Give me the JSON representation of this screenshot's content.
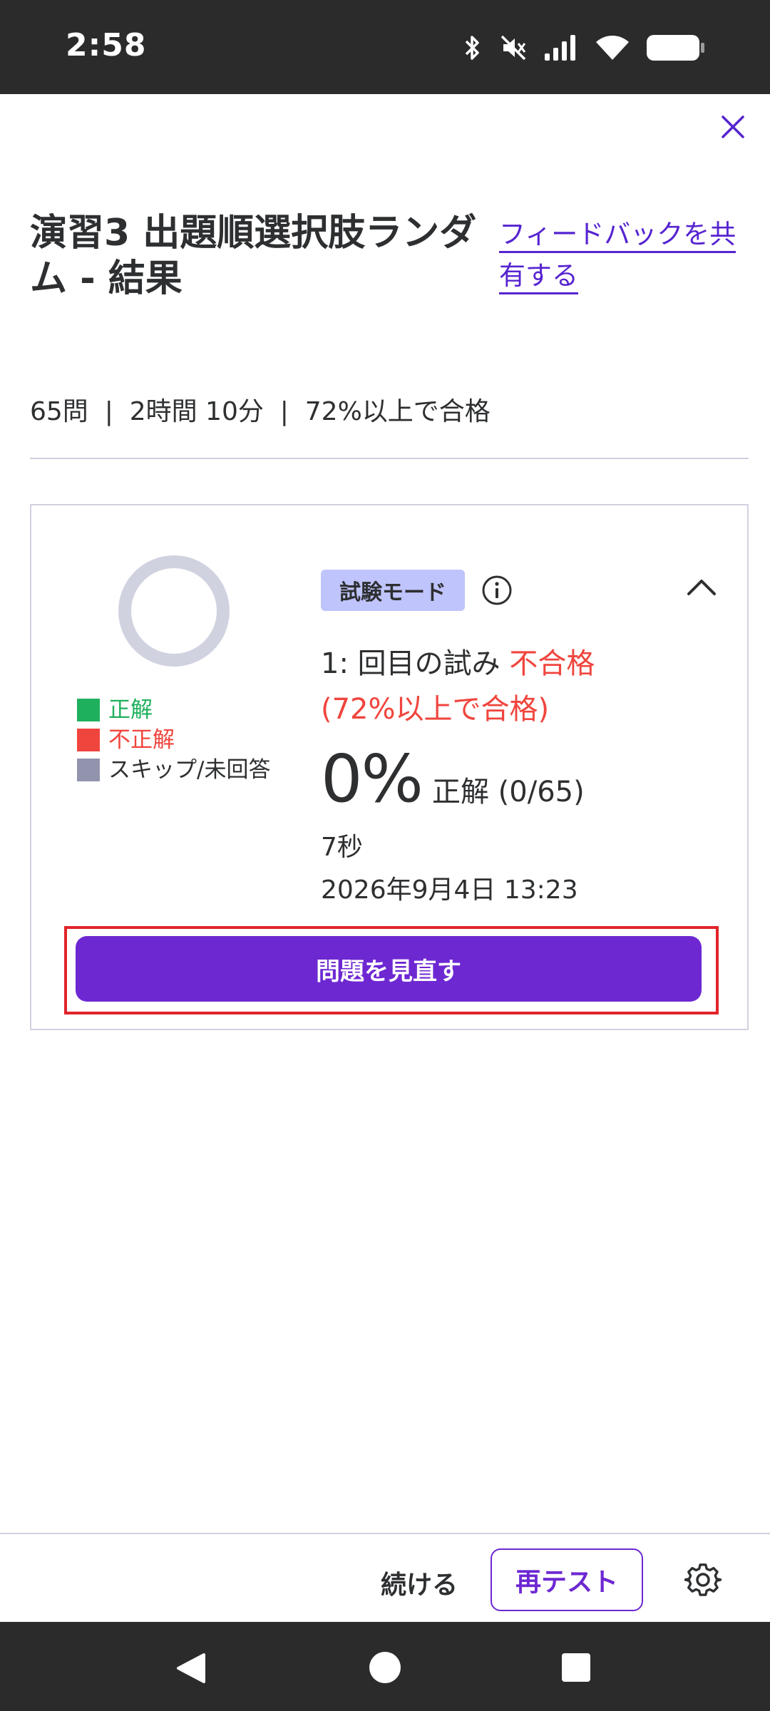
{
  "status_bar": {
    "time": "2:58"
  },
  "header": {
    "title": "演習3 出題順選択肢ランダム - 結果",
    "feedback_link": "フィードバックを共有する"
  },
  "meta": "65問  |  2時間 10分  |  72%以上で合格",
  "card": {
    "legend": [
      {
        "label": "正解",
        "color": "#1eb05d"
      },
      {
        "label": "不正解",
        "color": "#f0453d"
      },
      {
        "label": "スキップ/未回答",
        "color": "#9194ac"
      }
    ],
    "donut_color": "#d1d2e0",
    "mode_badge": "試験モード",
    "attempt_prefix": "1: 回目の試み",
    "attempt_status": "不合格",
    "pass_condition": "(72%以上で合格)",
    "score_percent": "0%",
    "score_label": "正解 (0/65)",
    "duration": "7秒",
    "date": "2026年9月4日 13:23",
    "review_button": "問題を見直す"
  },
  "bottom_bar": {
    "continue": "続ける",
    "retest": "再テスト"
  },
  "colors": {
    "accent": "#6d28d2",
    "link": "#5624d0",
    "fail": "#f0453d",
    "badge_bg": "#c0c4fc"
  }
}
